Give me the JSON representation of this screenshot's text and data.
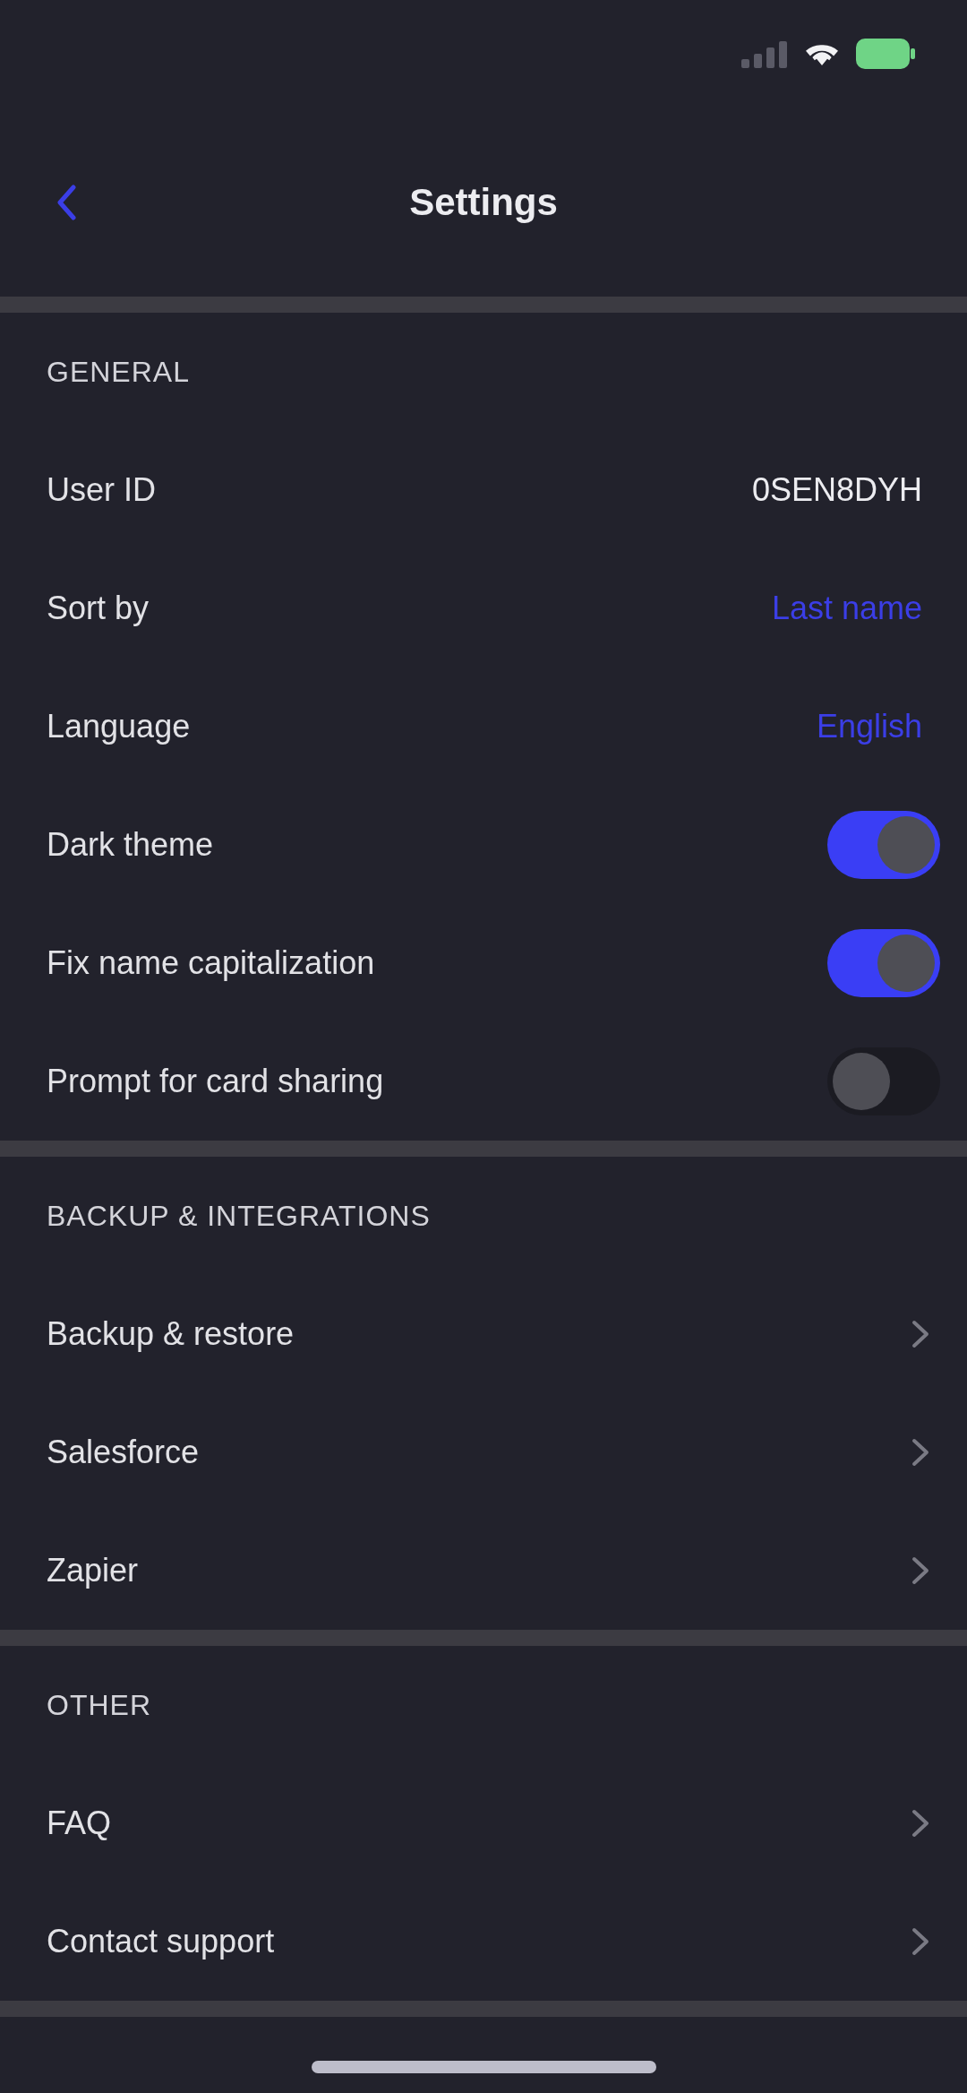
{
  "header": {
    "title": "Settings"
  },
  "sections": [
    {
      "title": "GENERAL",
      "items": [
        {
          "kind": "info",
          "label": "User ID",
          "value": "0SEN8DYH"
        },
        {
          "kind": "picker",
          "label": "Sort by",
          "value": "Last name"
        },
        {
          "kind": "picker",
          "label": "Language",
          "value": "English"
        },
        {
          "kind": "toggle",
          "label": "Dark theme",
          "on": true
        },
        {
          "kind": "toggle",
          "label": "Fix name capitalization",
          "on": true
        },
        {
          "kind": "toggle",
          "label": "Prompt for card sharing",
          "on": false
        }
      ]
    },
    {
      "title": "BACKUP & INTEGRATIONS",
      "items": [
        {
          "kind": "link",
          "label": "Backup & restore"
        },
        {
          "kind": "link",
          "label": "Salesforce"
        },
        {
          "kind": "link",
          "label": "Zapier"
        }
      ]
    },
    {
      "title": "OTHER",
      "items": [
        {
          "kind": "link",
          "label": "FAQ"
        },
        {
          "kind": "link",
          "label": "Contact support"
        }
      ]
    }
  ]
}
